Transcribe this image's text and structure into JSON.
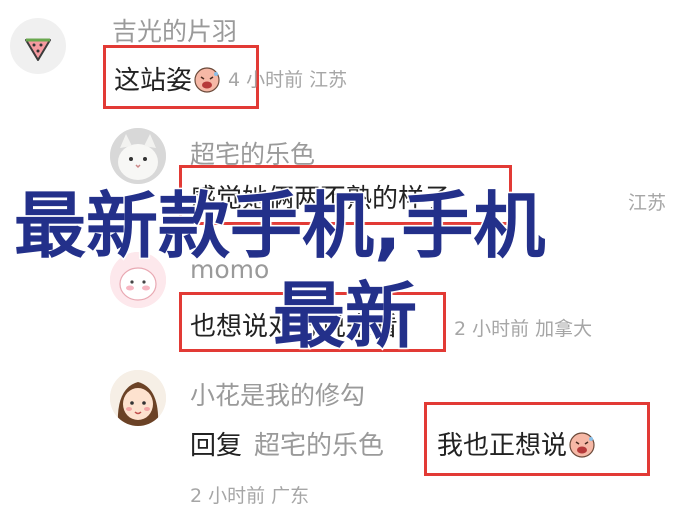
{
  "comments": [
    {
      "username": "吉光的片羽",
      "text": "这站姿",
      "meta": "4 小时前 江苏"
    },
    {
      "username": "超宅的乐色",
      "text": "感觉她俩两不熟的样子",
      "meta": "江苏"
    },
    {
      "username": "momo",
      "text": "也想说对方说来看",
      "meta": "2 小时前 加拿大"
    },
    {
      "username": "小花是我的修勾",
      "reply_label": "回复",
      "reply_to": "超宅的乐色",
      "text": "我也正想说",
      "meta": "2 小时前 广东"
    }
  ],
  "overlay": {
    "line1": "最新款手机,手机",
    "line2": "最新"
  },
  "colors": {
    "highlight": "#e23a35",
    "overlay_text": "#23308a",
    "meta_text": "#a6a6a6"
  }
}
